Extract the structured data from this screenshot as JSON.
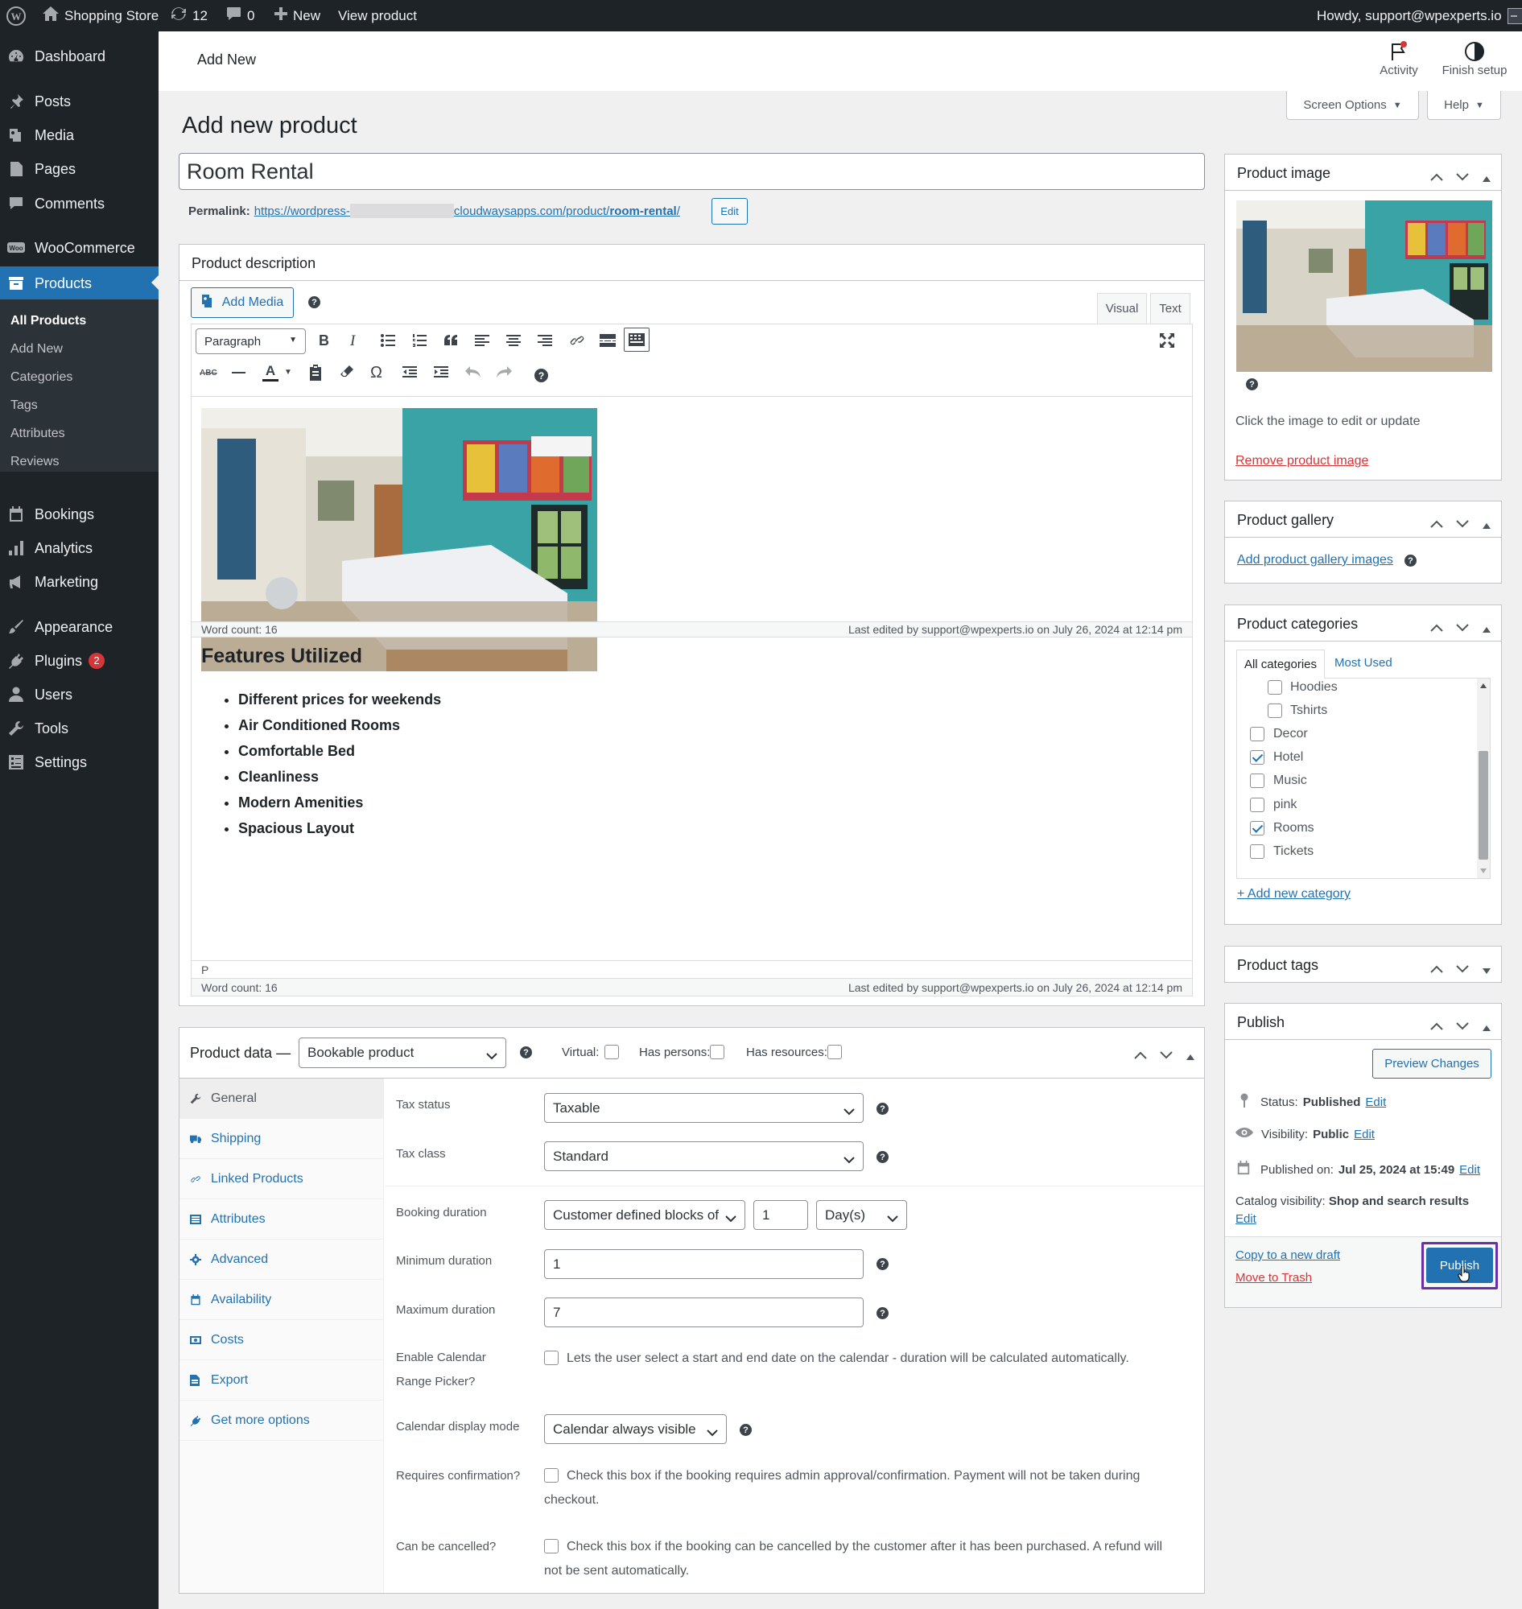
{
  "adminbar": {
    "site_name": "Shopping Store",
    "updates_count": "12",
    "comments_count": "0",
    "new_label": "New",
    "view_product_label": "View product",
    "howdy": "Howdy, support@wpexperts.io"
  },
  "sidebar": {
    "items": [
      {
        "label": "Dashboard",
        "icon": "dashboard-icon"
      },
      {
        "label": "Posts",
        "icon": "pin-icon"
      },
      {
        "label": "Media",
        "icon": "media-icon"
      },
      {
        "label": "Pages",
        "icon": "page-icon"
      },
      {
        "label": "Comments",
        "icon": "comment-icon"
      },
      {
        "label": "WooCommerce",
        "icon": "woo-icon"
      },
      {
        "label": "Products",
        "icon": "archive-icon"
      },
      {
        "label": "Bookings",
        "icon": "calendar-icon"
      },
      {
        "label": "Analytics",
        "icon": "chart-icon"
      },
      {
        "label": "Marketing",
        "icon": "megaphone-icon"
      },
      {
        "label": "Appearance",
        "icon": "brush-icon"
      },
      {
        "label": "Plugins",
        "icon": "plug-icon",
        "badge": "2"
      },
      {
        "label": "Users",
        "icon": "user-icon"
      },
      {
        "label": "Tools",
        "icon": "wrench-icon"
      },
      {
        "label": "Settings",
        "icon": "settings-icon"
      }
    ],
    "submenu": [
      "All Products",
      "Add New",
      "Categories",
      "Tags",
      "Attributes",
      "Reviews"
    ]
  },
  "header": {
    "breadcrumb": "Add New",
    "activity": "Activity",
    "finish_setup": "Finish setup",
    "screen_options": "Screen Options",
    "help": "Help"
  },
  "page": {
    "title": "Add new product",
    "product_title": "Room Rental",
    "permalink_label": "Permalink:",
    "permalink_start": "https://wordpress-",
    "permalink_end": "cloudwaysapps.com/product/",
    "permalink_slug": "room-rental",
    "permalink_trailing": "/",
    "edit_label": "Edit"
  },
  "description": {
    "title": "Product description",
    "add_media": "Add Media",
    "tab_visual": "Visual",
    "tab_text": "Text",
    "format_select": "Paragraph",
    "word_count": "Word count: 16",
    "last_edited": "Last edited by support@wpexperts.io on July 26, 2024 at 12:14 pm",
    "heading": "Features Utilized",
    "bullets": [
      "Different prices for weekends",
      "Air Conditioned Rooms",
      "Comfortable Bed",
      "Cleanliness",
      "Modern Amenities",
      "Spacious Layout"
    ],
    "path": "P",
    "word_count_2": "Word count: 16",
    "last_edited_2": "Last edited by support@wpexperts.io on July 26, 2024 at 12:14 pm"
  },
  "product_data": {
    "title": "Product data —",
    "type": "Bookable product",
    "virtual_label": "Virtual:",
    "has_persons_label": "Has persons:",
    "has_resources_label": "Has resources:",
    "tabs": [
      {
        "label": "General",
        "icon": "wrench-icon"
      },
      {
        "label": "Shipping",
        "icon": "truck-icon"
      },
      {
        "label": "Linked Products",
        "icon": "link-icon"
      },
      {
        "label": "Attributes",
        "icon": "list-icon"
      },
      {
        "label": "Advanced",
        "icon": "gear-icon"
      },
      {
        "label": "Availability",
        "icon": "calendar-icon"
      },
      {
        "label": "Costs",
        "icon": "money-icon"
      },
      {
        "label": "Export",
        "icon": "export-icon"
      },
      {
        "label": "Get more options",
        "icon": "plugin-icon"
      }
    ],
    "tax_status_label": "Tax status",
    "tax_status": "Taxable",
    "tax_class_label": "Tax class",
    "tax_class": "Standard",
    "booking_duration_label": "Booking duration",
    "booking_duration_type": "Customer defined blocks of",
    "booking_duration_value": "1",
    "booking_duration_unit": "Day(s)",
    "min_duration_label": "Minimum duration",
    "min_duration": "1",
    "max_duration_label": "Maximum duration",
    "max_duration": "7",
    "calendar_range_label_1": "Enable Calendar",
    "calendar_range_label_2": "Range Picker?",
    "calendar_range_desc": "Lets the user select a start and end date on the calendar - duration will be calculated automatically.",
    "calendar_mode_label": "Calendar display mode",
    "calendar_mode": "Calendar always visible",
    "requires_confirmation_label": "Requires confirmation?",
    "requires_confirmation_desc_1": "Check this box if the booking requires admin approval/confirmation. Payment will not be taken during",
    "requires_confirmation_desc_2": "checkout.",
    "can_cancel_label": "Can be cancelled?",
    "can_cancel_desc_1": "Check this box if the booking can be cancelled by the customer after it has been purchased. A refund will",
    "can_cancel_desc_2": "not be sent automatically."
  },
  "product_image": {
    "title": "Product image",
    "hint": "Click the image to edit or update",
    "remove": "Remove product image"
  },
  "gallery": {
    "title": "Product gallery",
    "add": "Add product gallery images"
  },
  "categories": {
    "title": "Product categories",
    "tab_all": "All categories",
    "tab_most_used": "Most Used",
    "items": [
      {
        "label": "Hoodies",
        "checked": false,
        "child": true
      },
      {
        "label": "Tshirts",
        "checked": false,
        "child": true
      },
      {
        "label": "Decor",
        "checked": false,
        "child": false
      },
      {
        "label": "Hotel",
        "checked": true,
        "child": false
      },
      {
        "label": "Music",
        "checked": false,
        "child": false
      },
      {
        "label": "pink",
        "checked": false,
        "child": false
      },
      {
        "label": "Rooms",
        "checked": true,
        "child": false
      },
      {
        "label": "Tickets",
        "checked": false,
        "child": false
      }
    ],
    "add_new": "+ Add new category"
  },
  "tags": {
    "title": "Product tags"
  },
  "publish": {
    "title": "Publish",
    "preview": "Preview Changes",
    "status_label": "Status:",
    "status_value": "Published",
    "visibility_label": "Visibility:",
    "visibility_value": "Public",
    "published_label": "Published on:",
    "published_value": "Jul 25, 2024 at 15:49",
    "catalog_label": "Catalog visibility:",
    "catalog_value": "Shop and search results",
    "edit": "Edit",
    "copy_draft": "Copy to a new draft",
    "trash": "Move to Trash",
    "publish_btn": "Publish"
  },
  "colors": {
    "accent": "#2271b1",
    "sidebar_bg": "#1d2327",
    "danger": "#d63638",
    "highlight_border": "#6b2fa8"
  }
}
